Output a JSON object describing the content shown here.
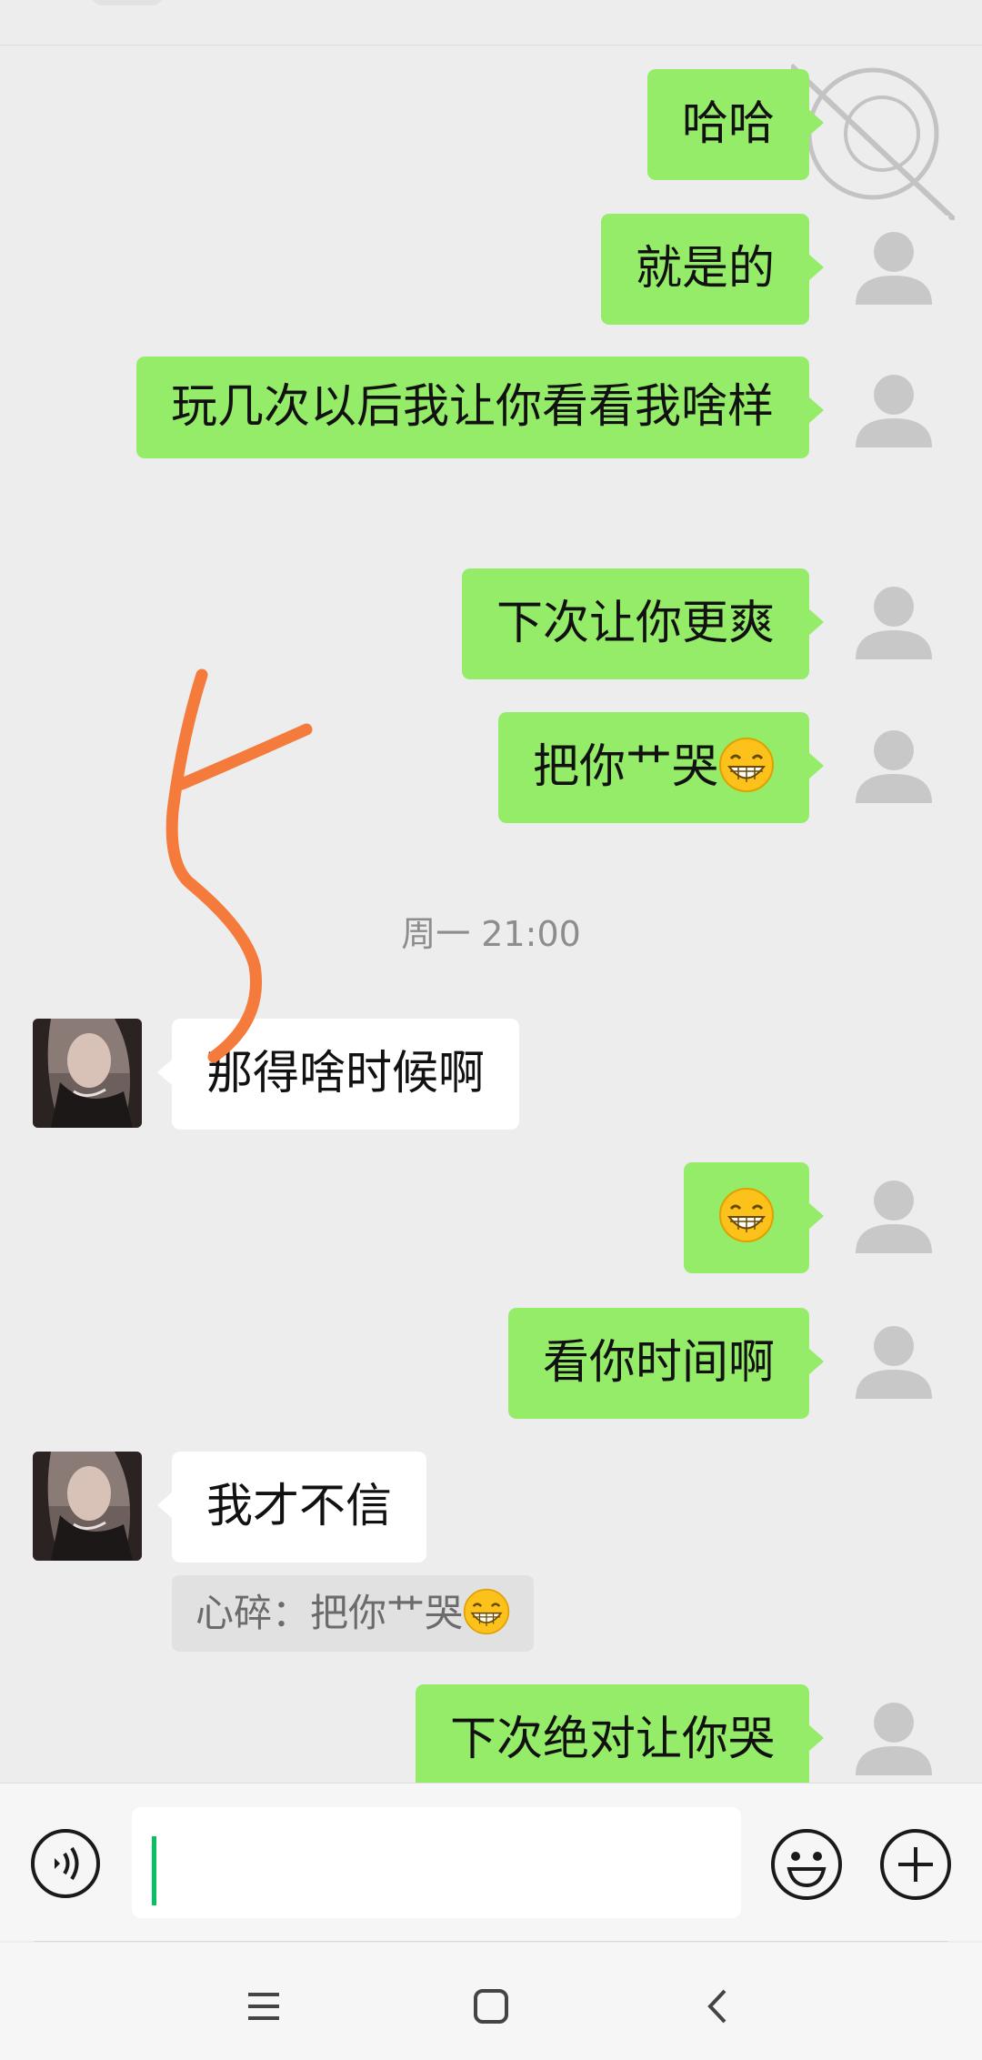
{
  "messages": [
    {
      "side": "right",
      "text": "哈哈"
    },
    {
      "side": "right",
      "text": "就是的"
    },
    {
      "side": "right",
      "text": "玩几次以后我让你看看我啥样"
    },
    {
      "side": "right",
      "text": "下次让你更爽"
    },
    {
      "side": "right",
      "text": "把你艹哭"
    },
    {
      "side": "center",
      "text": "周一 21:00"
    },
    {
      "side": "left",
      "text": "那得啥时候啊"
    },
    {
      "side": "right",
      "text": ""
    },
    {
      "side": "right",
      "text": "看你时间啊"
    },
    {
      "side": "left",
      "text": "我才不信"
    },
    {
      "side": "quote",
      "text": "心碎：把你艹哭"
    },
    {
      "side": "right",
      "text": "下次绝对让你哭"
    }
  ],
  "emoji_name": "grin-emoji",
  "colors": {
    "background": "#ededed",
    "sent_bubble": "#95ec69",
    "received_bubble": "#ffffff",
    "caret": "#07c160",
    "annotation_arrow": "#f47b3c"
  },
  "input": {
    "value": ""
  },
  "icons": {
    "voice": "voice-icon",
    "emoji": "smiley-icon",
    "plus": "plus-icon",
    "menu": "menu-icon",
    "home": "home-icon",
    "back": "back-icon"
  }
}
